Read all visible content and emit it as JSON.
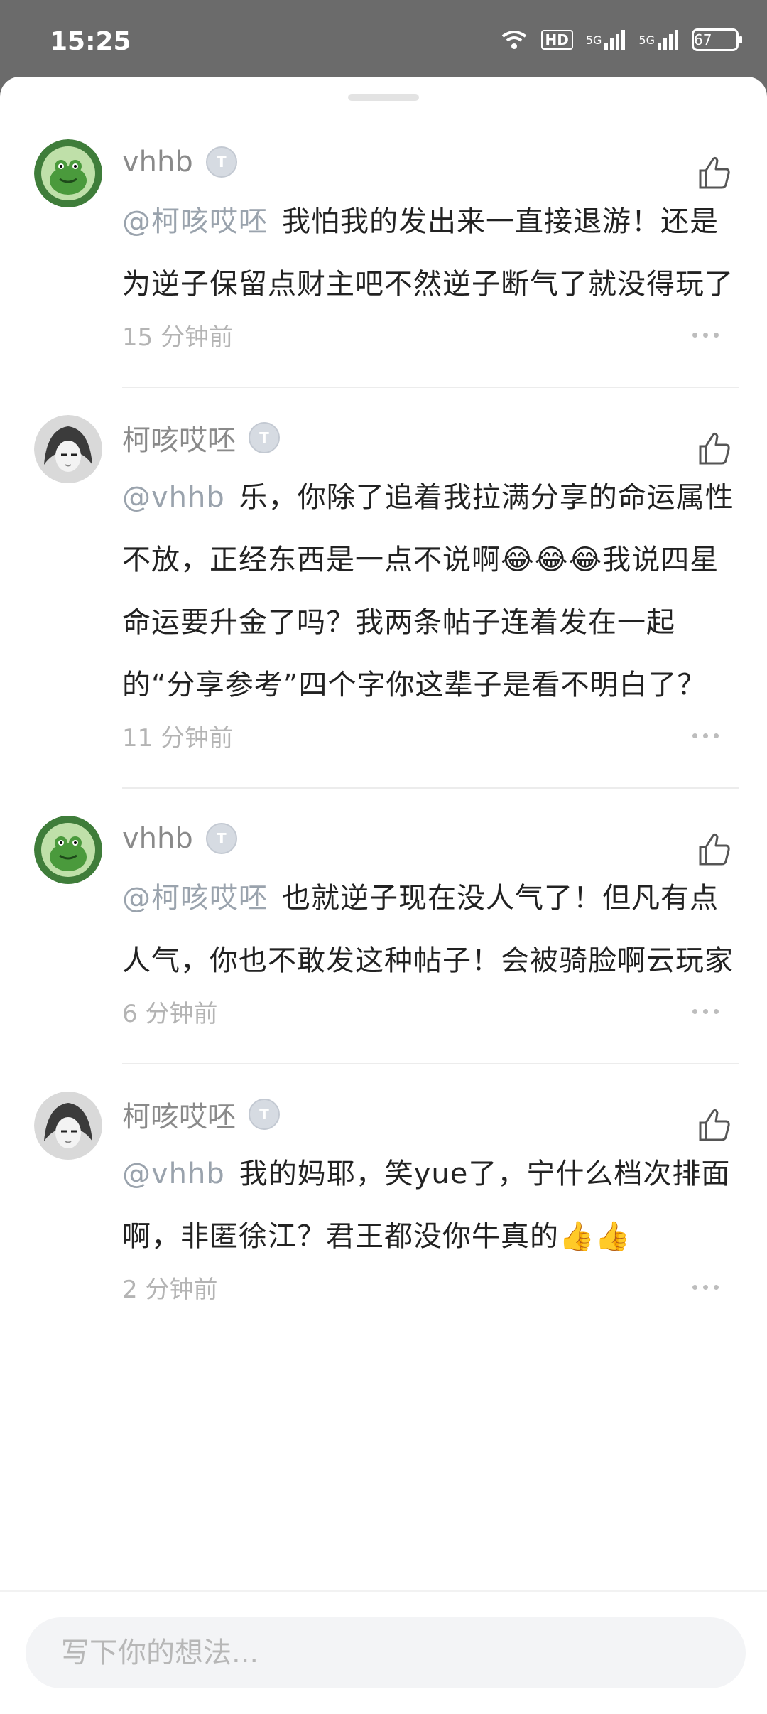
{
  "status_bar": {
    "time": "15:25",
    "hd_label": "HD",
    "network_1": "5G",
    "network_2": "5G",
    "battery": "67"
  },
  "comments": [
    {
      "username": "vhhb",
      "level": "T",
      "mention": "@柯咳哎呸",
      "text": "我怕我的发出来一直接退游！还是为逆子保留点财主吧不然逆子断气了就没得玩了",
      "time": "15 分钟前",
      "avatar_icon": "green-frog-avatar"
    },
    {
      "username": "柯咳哎呸",
      "level": "T",
      "mention": "@vhhb",
      "text": "乐，你除了追着我拉满分享的命运属性不放，正经东西是一点不说啊😂😂😂我说四星命运要升金了吗？我两条帖子连着发在一起的“分享参考”四个字你这辈子是看不明白了？",
      "time": "11 分钟前",
      "avatar_icon": "anime-girl-avatar"
    },
    {
      "username": "vhhb",
      "level": "T",
      "mention": "@柯咳哎呸",
      "text": "也就逆子现在没人气了！但凡有点人气，你也不敢发这种帖子！会被骑脸啊云玩家",
      "time": "6 分钟前",
      "avatar_icon": "green-frog-avatar"
    },
    {
      "username": "柯咳哎呸",
      "level": "T",
      "mention": "@vhhb",
      "text": "我的妈耶，笑yue了，宁什么档次排面啊，非匿徐江？君王都没你牛真的👍👍",
      "time": "2 分钟前",
      "avatar_icon": "anime-girl-avatar"
    }
  ],
  "composer": {
    "placeholder": "写下你的想法..."
  },
  "colors": {
    "mention": "#9aa3ad",
    "text": "#222222",
    "meta": "#b4b4b4"
  }
}
